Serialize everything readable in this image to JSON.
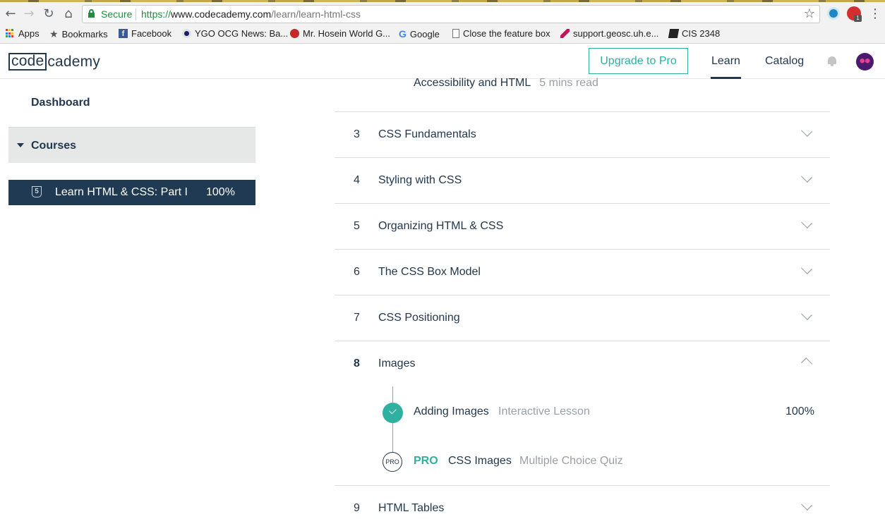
{
  "browser": {
    "secure_label": "Secure",
    "url_scheme": "https://",
    "url_host": "www.codecademy.com",
    "url_path": "/learn/learn-html-css",
    "extension_badge": "1",
    "bookmarks": [
      {
        "label": "Apps",
        "icon": "apps-grid-icon"
      },
      {
        "label": "Bookmarks",
        "icon": "star-icon"
      },
      {
        "label": "Facebook",
        "icon": "facebook-icon"
      },
      {
        "label": "YGO OCG News: Ba...",
        "icon": "site-icon"
      },
      {
        "label": "Mr. Hosein World G...",
        "icon": "apple-icon"
      },
      {
        "label": "Google",
        "icon": "google-icon"
      },
      {
        "label": "Close the feature box",
        "icon": "page-icon"
      },
      {
        "label": "support.geosc.uh.e...",
        "icon": "feather-icon"
      },
      {
        "label": "CIS 2348",
        "icon": "book-icon"
      }
    ]
  },
  "header": {
    "logo_boxed": "code",
    "logo_rest": "cademy",
    "upgrade_label": "Upgrade to Pro",
    "nav_learn": "Learn",
    "nav_catalog": "Catalog"
  },
  "sidebar": {
    "dashboard": "Dashboard",
    "courses": "Courses",
    "course": {
      "title": "Learn HTML & CSS: Part I",
      "progress": "100%",
      "icon": "html5-icon"
    }
  },
  "main": {
    "prev_lesson": {
      "title": "Accessibility and HTML",
      "meta": "5 mins read"
    },
    "units": [
      {
        "num": "3",
        "title": "CSS Fundamentals"
      },
      {
        "num": "4",
        "title": "Styling with CSS"
      },
      {
        "num": "5",
        "title": "Organizing HTML & CSS"
      },
      {
        "num": "6",
        "title": "The CSS Box Model"
      },
      {
        "num": "7",
        "title": "CSS Positioning"
      },
      {
        "num": "8",
        "title": "Images"
      },
      {
        "num": "9",
        "title": "HTML Tables"
      }
    ],
    "lessons": [
      {
        "title": "Adding Images",
        "type": "Interactive Lesson",
        "progress": "100%"
      },
      {
        "pro_icon_text": "PRO",
        "pro_tag": "PRO",
        "title": "CSS Images",
        "type": "Multiple Choice Quiz"
      }
    ]
  },
  "colors": {
    "brand_dark": "#23374d",
    "accent_teal": "#2eb1a0",
    "sidebar_active": "#1f3a52"
  }
}
